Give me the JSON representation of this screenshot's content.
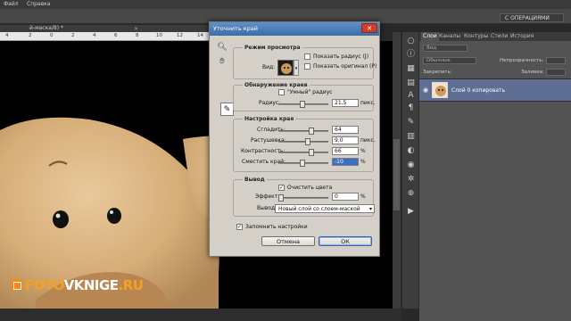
{
  "menubar": {
    "items": [
      "Файл",
      "Справка"
    ]
  },
  "workspace_dropdown": "С ОПЕРАЦИЯМИ",
  "document": {
    "tab_title": "й-маска/8) *",
    "ruler_ticks": [
      "4",
      "2",
      "0",
      "2",
      "4",
      "6",
      "8",
      "10",
      "12",
      "14"
    ]
  },
  "layers_panel": {
    "tabs": [
      "Слои",
      "Каналы",
      "Контуры",
      "Стили",
      "История"
    ],
    "search_placeholder": "Вид",
    "blend_mode": "Обычные",
    "opacity_label": "Непрозрачность:",
    "lock_label": "Закрепить:",
    "fill_label": "Заливка:",
    "layer_name": "Слой 0 копировать"
  },
  "dialog": {
    "title": "Уточнить край",
    "view_mode": {
      "heading": "Режим просмотра",
      "view_label": "Вид:",
      "show_radius": "Показать радиус (J)",
      "show_original": "Показать оригинал (P)"
    },
    "edge_detection": {
      "heading": "Обнаружение краев",
      "smart_radius": "\"Умный\" радиус",
      "radius_label": "Радиус:",
      "radius_value": "21,5",
      "radius_unit": "пикс."
    },
    "adjust_edge": {
      "heading": "Настройка края",
      "smooth_label": "Сгладить:",
      "smooth_value": "64",
      "feather_label": "Растушевка:",
      "feather_value": "9,0",
      "feather_unit": "пикс.",
      "contrast_label": "Контрастность:",
      "contrast_value": "66",
      "contrast_unit": "%",
      "shift_label": "Сместить край:",
      "shift_value": "-10",
      "shift_unit": "%"
    },
    "output": {
      "heading": "Вывод",
      "decontaminate": "Очистить цвета",
      "amount_label": "Эффект:",
      "amount_value": "0",
      "amount_unit": "%",
      "output_to_label": "Вывод в:",
      "output_to_value": "Новый слой со слоем-маской"
    },
    "remember": "Запомнить настройки",
    "cancel": "Отмена",
    "ok": "ОК"
  },
  "logo": {
    "part1": "FOTO",
    "part2": "VKNIGE",
    "part3": ".RU"
  }
}
